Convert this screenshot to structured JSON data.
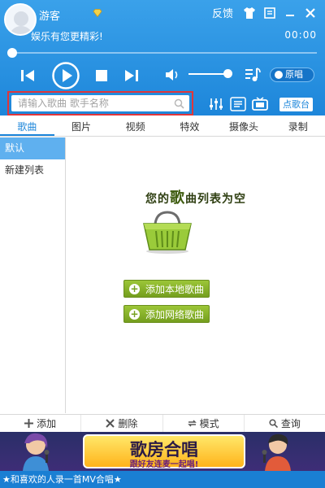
{
  "user": {
    "name": "游客"
  },
  "header": {
    "tagline": "娱乐有您更精彩!",
    "time": "00:00",
    "feedback_label": "反馈"
  },
  "player": {
    "progress": 0,
    "volume": 0.85,
    "original_vocal_label": "原唱"
  },
  "search": {
    "placeholder": "请输入歌曲 歌手名称",
    "value": ""
  },
  "tools": {
    "dian_ge_tai_label": "点歌台"
  },
  "tabs": [
    "歌曲",
    "图片",
    "视频",
    "特效",
    "摄像头",
    "录制"
  ],
  "sidebar": {
    "items": [
      "默认",
      "新建列表"
    ]
  },
  "empty": {
    "title_pre": "您的",
    "title_big": "歌",
    "title_post": "曲列表为空",
    "add_local_label": "添加本地歌曲",
    "add_online_label": "添加网络歌曲"
  },
  "bottom": {
    "add_label": "添加",
    "delete_label": "删除",
    "mode_label": "模式",
    "query_label": "查询"
  },
  "banner": {
    "title": "歌房合唱",
    "subtitle": "跟好友连麦一起唱!"
  },
  "footer": {
    "text": "★和喜欢的人录一首MV合唱★"
  },
  "colors": {
    "accent": "#1d86da",
    "highlight": "#e0363a",
    "green": "#8cbf2e"
  }
}
